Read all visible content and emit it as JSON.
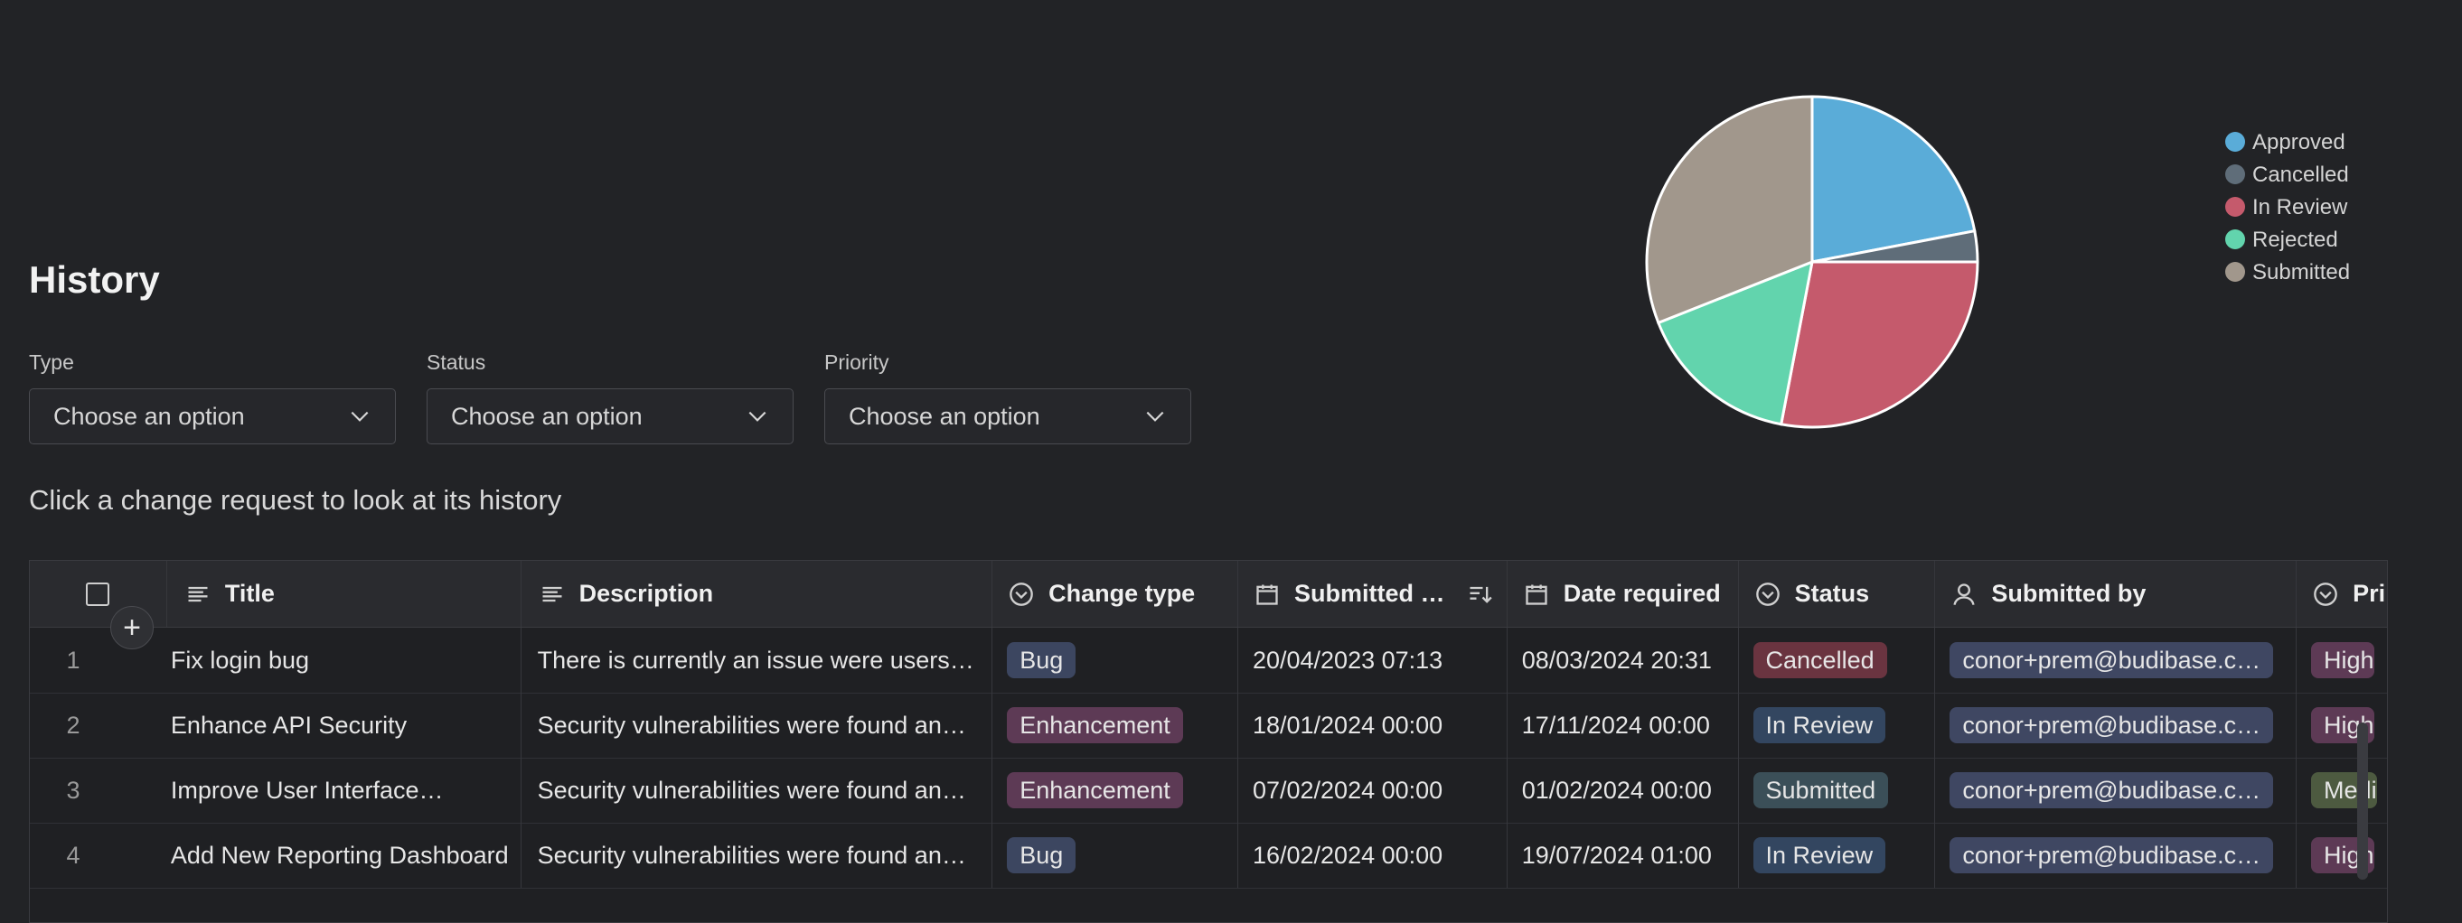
{
  "page": {
    "title": "History",
    "hint": "Click a change request to look at its history"
  },
  "filters": [
    {
      "label": "Type",
      "placeholder": "Choose an option"
    },
    {
      "label": "Status",
      "placeholder": "Choose an option"
    },
    {
      "label": "Priority",
      "placeholder": "Choose an option"
    }
  ],
  "chart_data": {
    "type": "pie",
    "categories": [
      "Approved",
      "Cancelled",
      "In Review",
      "Rejected",
      "Submitted"
    ],
    "values": [
      22,
      3,
      28,
      16,
      31
    ],
    "colors": [
      "#5aacd8",
      "#5f6d79",
      "#c55a6c",
      "#62d4ad",
      "#a1978c"
    ],
    "legend_position": "top-right"
  },
  "table": {
    "columns": [
      "Title",
      "Description",
      "Change type",
      "Submitted …",
      "Date required",
      "Status",
      "Submitted by",
      "Pri"
    ],
    "rows": [
      {
        "num": "1",
        "title": "Fix login bug",
        "description": "There is currently an issue were users…",
        "change_type": "Bug",
        "submitted": "20/04/2023 07:13",
        "required": "08/03/2024 20:31",
        "status": "Cancelled",
        "submitted_by": "conor+prem@budibase.c…",
        "priority": "High"
      },
      {
        "num": "2",
        "title": "Enhance API Security",
        "description": "Security vulnerabilities were found an…",
        "change_type": "Enhancement",
        "submitted": "18/01/2024 00:00",
        "required": "17/11/2024 00:00",
        "status": "In Review",
        "submitted_by": "conor+prem@budibase.c…",
        "priority": "High"
      },
      {
        "num": "3",
        "title": "Improve User Interface…",
        "description": "Security vulnerabilities were found an…",
        "change_type": "Enhancement",
        "submitted": "07/02/2024 00:00",
        "required": "01/02/2024 00:00",
        "status": "Submitted",
        "submitted_by": "conor+prem@budibase.c…",
        "priority": "Medi"
      },
      {
        "num": "4",
        "title": "Add New Reporting Dashboard",
        "description": "Security vulnerabilities were found an…",
        "change_type": "Bug",
        "submitted": "16/02/2024 00:00",
        "required": "19/07/2024 01:00",
        "status": "In Review",
        "submitted_by": "conor+prem@budibase.c…",
        "priority": "High"
      }
    ]
  },
  "colors": {
    "background": "#222326",
    "pill_bug": "#3c4660",
    "pill_enhancement": "#5d3a55",
    "pill_cancelled": "#6a3440",
    "pill_in_review": "#334660",
    "pill_submitted": "#3b4f58",
    "pill_user": "#3f4762",
    "pill_high": "#5d3a55",
    "pill_medium": "#4d5a40"
  },
  "icons": {
    "title_column": "text-lines-icon",
    "change_type_column": "chevron-circle-icon",
    "date_column": "calendar-icon",
    "status_column": "chevron-circle-icon",
    "submitted_by_column": "user-icon",
    "sort": "sort-descending-icon",
    "add": "plus-icon",
    "dropdown": "chevron-down-icon"
  }
}
